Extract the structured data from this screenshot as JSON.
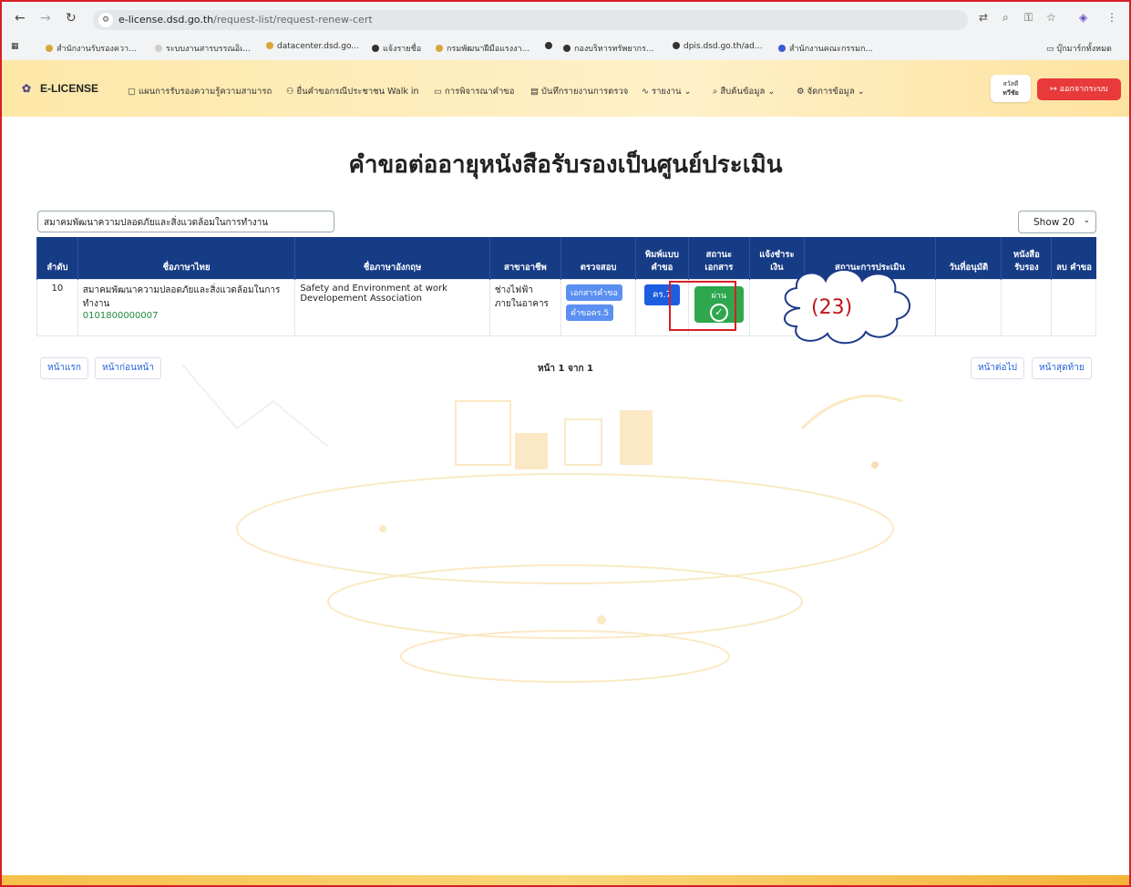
{
  "browser": {
    "url_host": "e-license.dsd.go.th",
    "url_path": "/request-list/request-renew-cert",
    "bookmarks": [
      "สำนักงานรับรองควา...",
      "ระบบงานสารบรรณอิเ...",
      "datacenter.dsd.go...",
      "แจ้งรายชื่อ",
      "กรมพัฒนาฝีมือแรงงา...",
      "",
      "กองบริหารทรัพยากร...",
      "dpis.dsd.go.th/ad...",
      "สำนักงานคณะกรรมก..."
    ],
    "all_bookmarks": "บุ๊กมาร์กทั้งหมด"
  },
  "nav": {
    "logo": "E-LICENSE",
    "menu": [
      "แผนการรับรองความรู้ความสามารถ",
      "ยื่นคำขอกรณีประชาชน Walk in",
      "การพิจารณาคำขอ",
      "บันทึกรายงานการตรวจ",
      "รายงาน",
      "สืบค้นข้อมูล",
      "จัดการข้อมูล"
    ],
    "greet_line1": "สวัสดี",
    "greet_line2": "ทวีชัย",
    "logout": "ออกจากระบบ"
  },
  "page": {
    "title": "คำขอต่ออายุหนังสือรับรองเป็นศูนย์ประเมิน",
    "search_value": "สมาคมพัฒนาความปลอดภัยและสิ่งแวดล้อมในการทำงาน",
    "show": "Show 20"
  },
  "table": {
    "headers": [
      "ลำดับ",
      "ชื่อภาษาไทย",
      "ชื่อภาษาอังกฤษ",
      "สาขาอาชีพ",
      "ตรวจสอบ",
      "พิมพ์แบบ คำขอ",
      "สถานะ เอกสาร",
      "แจ้งชำระ เงิน",
      "สถานะการประเมิน",
      "วันที่อนุมัติ",
      "หนังสือ รับรอง",
      "ลบ คำขอ"
    ],
    "row": {
      "no": "10",
      "thai_name": "สมาคมพัฒนาความปลอดภัยและสิ่งแวดล้อมในการทำงาน",
      "code": "0101800000007",
      "eng_name": "Safety and Environment at work Developement Association",
      "branch": "ช่างไฟฟ้าภายในอาคาร",
      "check_doc": "เอกสารคำขอ",
      "check_form": "คำขอคร.5",
      "print": "คร.7",
      "status": "ผ่าน"
    }
  },
  "annotation": "(23)",
  "pager": {
    "first": "หน้าแรก",
    "prev": "หน้าก่อนหน้า",
    "info": "หน้า 1 จาก 1",
    "next": "หน้าต่อไป",
    "last": "หน้าสุดท้าย"
  }
}
